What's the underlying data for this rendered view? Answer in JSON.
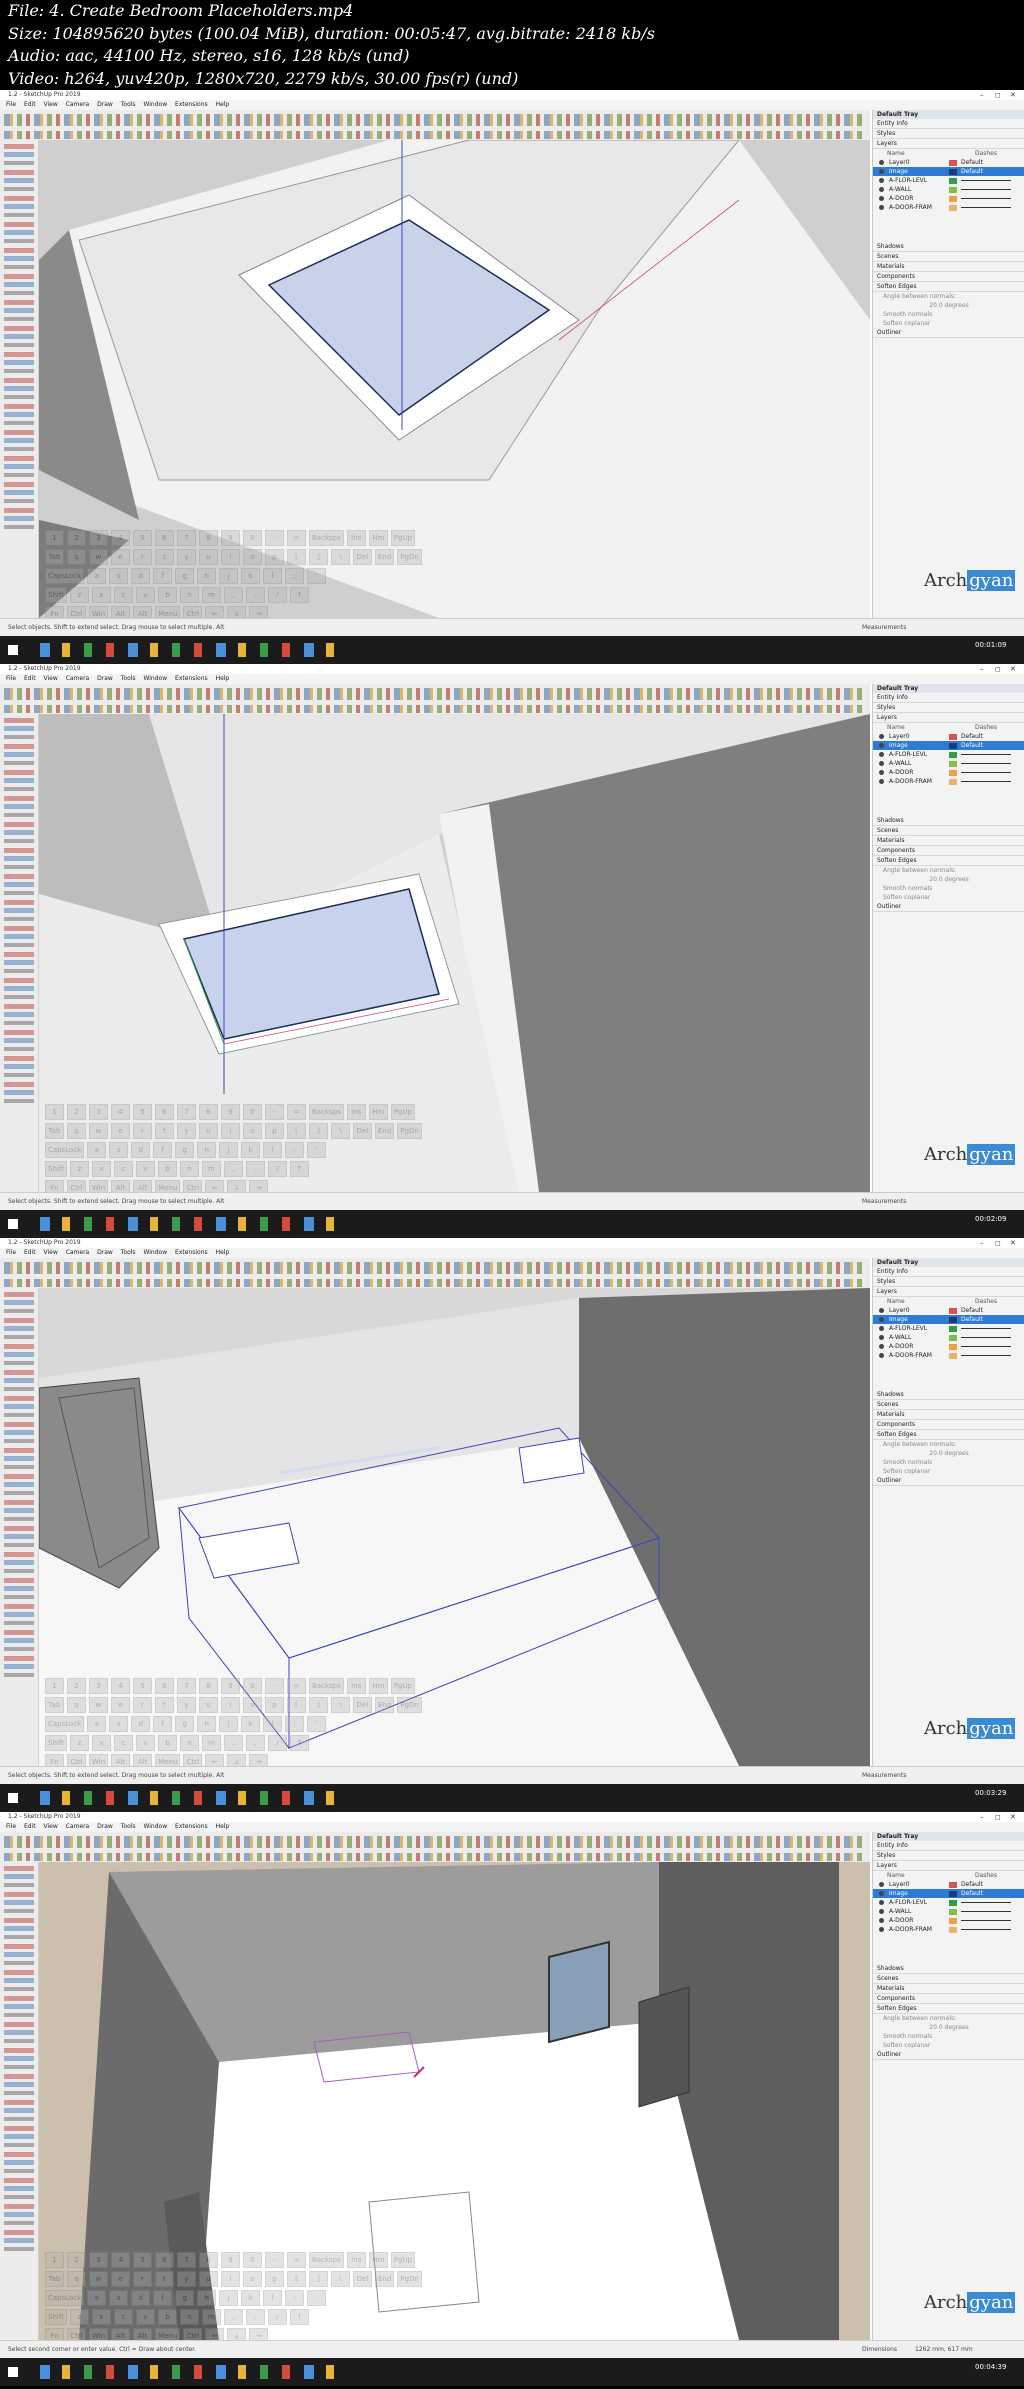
{
  "header": {
    "file": "File: 4. Create Bedroom Placeholders.mp4",
    "size": "Size: 104895620 bytes (100.04 MiB), duration: 00:05:47, avg.bitrate: 2418 kb/s",
    "audio": "Audio: aac, 44100 Hz, stereo, s16, 128 kb/s (und)",
    "video": "Video: h264, yuv420p, 1280x720, 2279 kb/s, 30.00 fps(r) (und)"
  },
  "app": {
    "window_title": "1.2 - SketchUp Pro 2019",
    "menus": [
      "File",
      "Edit",
      "View",
      "Camera",
      "Draw",
      "Tools",
      "Window",
      "Extensions",
      "Help"
    ],
    "window_controls": [
      "–",
      "◻",
      "✕"
    ]
  },
  "tray": {
    "title": "Default Tray",
    "sections_top": [
      "Entity Info",
      "Styles",
      "Layers"
    ],
    "layer_columns": [
      "Name",
      "Dashes"
    ],
    "default_label": "Default",
    "layers": [
      {
        "name": "Layer0",
        "color": "#d9534f",
        "selected": false
      },
      {
        "name": "Image",
        "color": "#1c3a78",
        "selected": true
      },
      {
        "name": "A-FLOR-LEVL",
        "color": "#2f9e44",
        "selected": false
      },
      {
        "name": "A-WALL",
        "color": "#7fc241",
        "selected": false
      },
      {
        "name": "A-DOOR",
        "color": "#f0a04b",
        "selected": false
      },
      {
        "name": "A-DOOR-FRAM",
        "color": "#e9b36b",
        "selected": false
      }
    ],
    "sections_bottom": [
      "Shadows",
      "Scenes",
      "Materials",
      "Components",
      "Soften Edges"
    ],
    "soften": {
      "angle_label": "Angle between normals:",
      "degrees": "20.0 degrees",
      "smooth": "Smooth normals",
      "coplanar": "Soften coplanar"
    },
    "outliner": "Outliner"
  },
  "status": {
    "hint_1": "Select objects. Shift to extend select. Drag mouse to select multiple. Alt",
    "hint_2": "Select objects. Shift to extend select. Drag mouse to select multiple. Alt",
    "hint_3": "Select objects. Shift to extend select. Drag mouse to select multiple. Alt",
    "hint_4": "Select second corner or enter value. Ctrl = Draw about center.",
    "measurements_label": "Measurements",
    "dimensions_label": "Dimensions",
    "dimensions_value": "1262 mm, 617 mm"
  },
  "keyboard": {
    "row1": [
      "1",
      "2",
      "3",
      "4",
      "5",
      "6",
      "7",
      "8",
      "9",
      "0",
      "-",
      "=",
      "Backsps"
    ],
    "row2": [
      "Tab",
      "q",
      "w",
      "e",
      "r",
      "t",
      "y",
      "u",
      "i",
      "o",
      "p",
      "[",
      "]",
      "\\"
    ],
    "row3": [
      "CapsLock",
      "a",
      "s",
      "d",
      "f",
      "g",
      "h",
      "j",
      "k",
      "l",
      ";",
      "'"
    ],
    "row4": [
      "Shift",
      "z",
      "x",
      "c",
      "v",
      "b",
      "n",
      "m",
      ",",
      ".",
      "/"
    ],
    "row5": [
      "Fn",
      "Ctrl",
      "Win",
      "Alt",
      "Alt",
      "Menu",
      "Ctrl"
    ],
    "nav": [
      "Ins",
      "Hm",
      "PgUp",
      "Del",
      "End",
      "PgDn",
      "↑",
      "←",
      "↓",
      "→"
    ]
  },
  "frames": [
    {
      "timestamp": "00:01:09"
    },
    {
      "timestamp": "00:02:09"
    },
    {
      "timestamp": "00:03:29"
    },
    {
      "timestamp": "00:04:39"
    }
  ],
  "logo": {
    "text_a": "Arch",
    "text_b": "gyan"
  }
}
